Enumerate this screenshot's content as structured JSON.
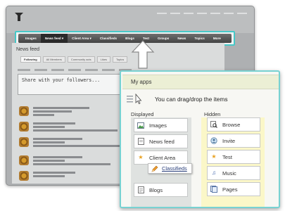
{
  "back": {
    "nav": [
      "Images",
      "News feed",
      "Client Area",
      "Classifieds",
      "Blogs",
      "Test",
      "Groups",
      "News",
      "Topics",
      "More"
    ],
    "feed": {
      "title": "News feed",
      "tabs": [
        "Following",
        "All Members",
        "Community acts",
        "Likes",
        "Topics"
      ],
      "share_placeholder": "Share with your followers..."
    }
  },
  "front": {
    "title": "My apps",
    "drag_hint": "You can drag/drop the items",
    "displayed_label": "Displayed",
    "hidden_label": "Hidden",
    "displayed": [
      {
        "label": "Images",
        "icon": "images-icon"
      },
      {
        "label": "News feed",
        "icon": "news-feed-icon"
      },
      {
        "label": "Client Area",
        "icon": "star-icon"
      },
      {
        "label": "Blogs",
        "icon": "blogs-icon"
      }
    ],
    "hidden": [
      {
        "label": "Browse",
        "icon": "browse-icon"
      },
      {
        "label": "Invite",
        "icon": "invite-icon"
      },
      {
        "label": "Test",
        "icon": "star-icon"
      },
      {
        "label": "Music",
        "icon": "music-icon"
      },
      {
        "label": "Pages",
        "icon": "pages-icon"
      }
    ],
    "dragging_item": {
      "label": "Classifieds",
      "icon": "pencil-icon"
    }
  },
  "colors": {
    "highlight": "#46c8c8",
    "panel_header": "#ecefd5",
    "hidden_column": "#fbf7c8",
    "displayed_column": "#dfe2e0"
  }
}
